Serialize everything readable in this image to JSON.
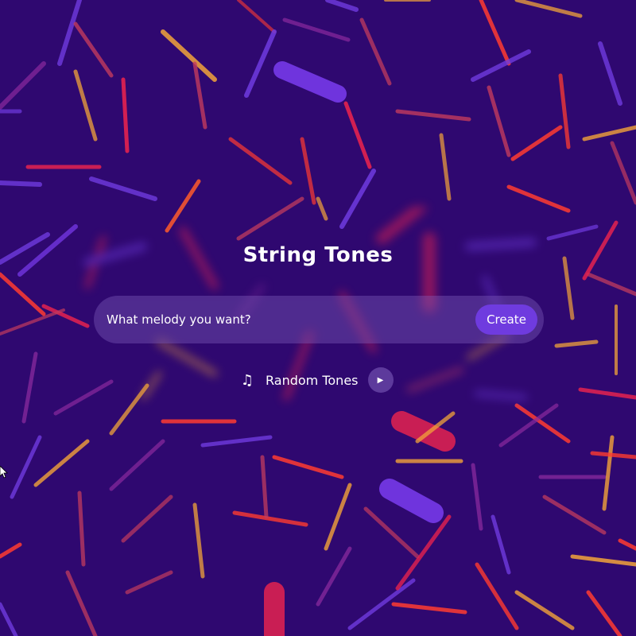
{
  "app": {
    "title": "String Tones"
  },
  "prompt": {
    "placeholder": "What melody you want?",
    "create_label": "Create"
  },
  "random": {
    "label": "Random Tones",
    "note_glyph": "♫",
    "play_glyph": "▶"
  },
  "colors": {
    "background": "#2f0870",
    "accent": "#6f3bdf",
    "stick_palette": [
      "#ff3b30",
      "#e4224f",
      "#f2a33a",
      "#6f3bdf",
      "#8a2a9e",
      "#c23b5e"
    ]
  }
}
